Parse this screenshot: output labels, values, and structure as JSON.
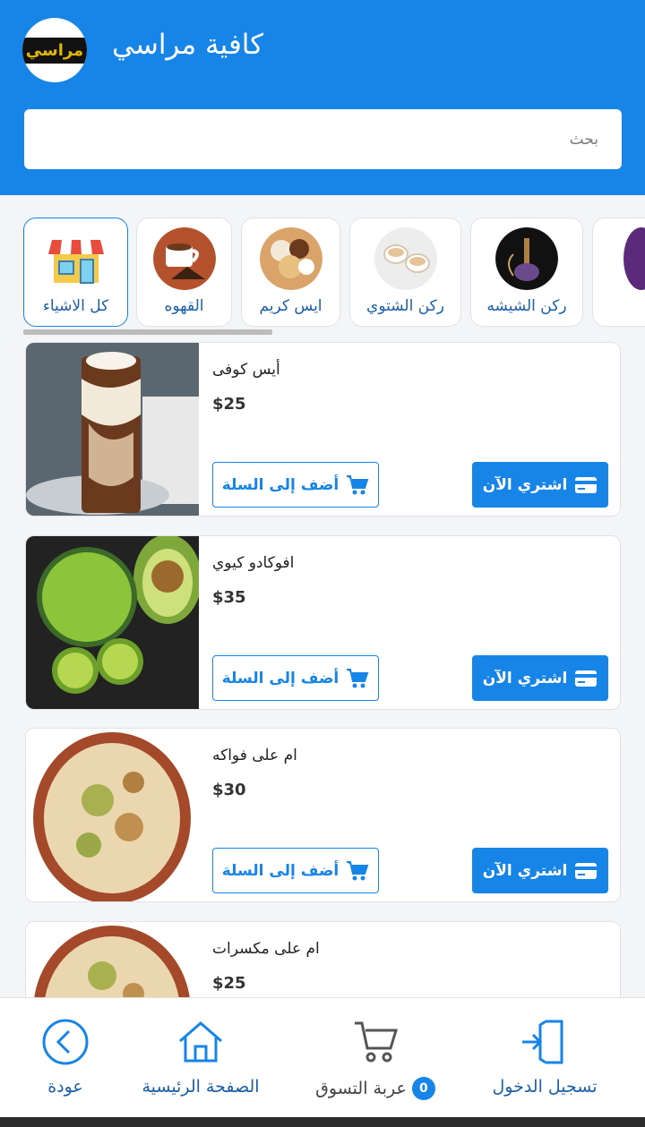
{
  "header": {
    "logo_text": "مراسي",
    "title": "كافية مراسي",
    "search_placeholder": "بحث"
  },
  "categories": [
    {
      "label": "كل الاشياء",
      "icon": "store-icon",
      "active": true
    },
    {
      "label": "القهوه",
      "icon": "coffee-image"
    },
    {
      "label": "ايس كريم",
      "icon": "ice-cream-image"
    },
    {
      "label": "ركن الشتوي",
      "icon": "winter-drinks-image"
    },
    {
      "label": "ركن الشيشه",
      "icon": "shisha-image"
    }
  ],
  "products": [
    {
      "name": "أيس كوفى",
      "price": "$25",
      "add_label": "أضف إلى السلة",
      "buy_label": "اشتري الآن"
    },
    {
      "name": "افوكادو كيوي",
      "price": "$35",
      "add_label": "أضف إلى السلة",
      "buy_label": "اشتري الآن"
    },
    {
      "name": "ام على فواكه",
      "price": "$30",
      "add_label": "أضف إلى السلة",
      "buy_label": "اشتري الآن"
    },
    {
      "name": "ام على مكسرات",
      "price": "$25"
    }
  ],
  "bottom_nav": {
    "back": "عودة",
    "home": "الصفحة الرئيسية",
    "cart": "عربة التسوق",
    "cart_count": "0",
    "login": "تسجيل الدخول"
  },
  "colors": {
    "primary": "#1785e8",
    "label": "#1a5fa8"
  }
}
